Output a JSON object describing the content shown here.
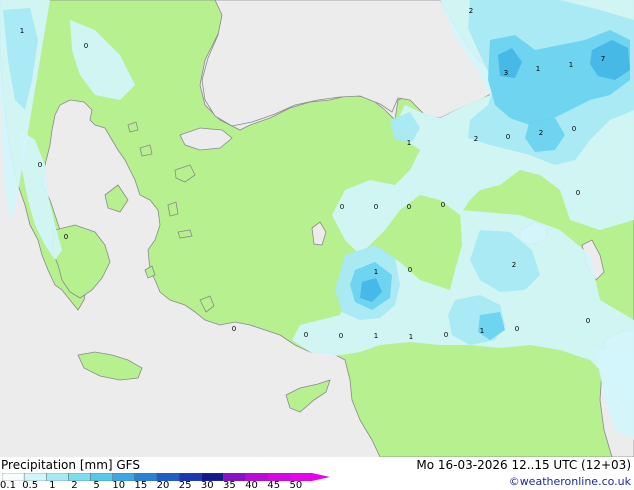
{
  "map": {
    "colors": {
      "sea": "#ececec",
      "land": "#b7f08e",
      "coast": "#8a8a8a",
      "precip_light": "#d2f5fb",
      "precip_med": "#a6e9f4",
      "precip_heavy": "#6ad3ee",
      "precip_strong": "#41b6e6"
    },
    "point_labels": [
      "2",
      "1",
      "0",
      "3",
      "1",
      "1",
      "7",
      "0",
      "1",
      "2",
      "0",
      "2",
      "0",
      "0",
      "0",
      "0",
      "0",
      "0",
      "2",
      "1",
      "0",
      "0",
      "0",
      "1",
      "1",
      "0",
      "1",
      "0",
      "0",
      "0",
      "0"
    ]
  },
  "legend": {
    "title": "Precipitation [mm]  GFS",
    "datetime": "Mo 16-03-2026 12..15 UTC (12+03)",
    "credit": "©weatheronline.co.uk",
    "ticks": [
      "0.1",
      "0.5",
      "1",
      "2",
      "5",
      "10",
      "15",
      "20",
      "25",
      "30",
      "35",
      "40",
      "45",
      "50"
    ],
    "colors": [
      "#f6fdfd",
      "#d2f5fb",
      "#a6e9f4",
      "#7ddcf0",
      "#55c9ea",
      "#3aa8e4",
      "#2b83d8",
      "#1f5ec8",
      "#1a38b4",
      "#101a8c",
      "#8a10c8",
      "#b80cd6",
      "#d408e0",
      "#e604ea"
    ]
  }
}
